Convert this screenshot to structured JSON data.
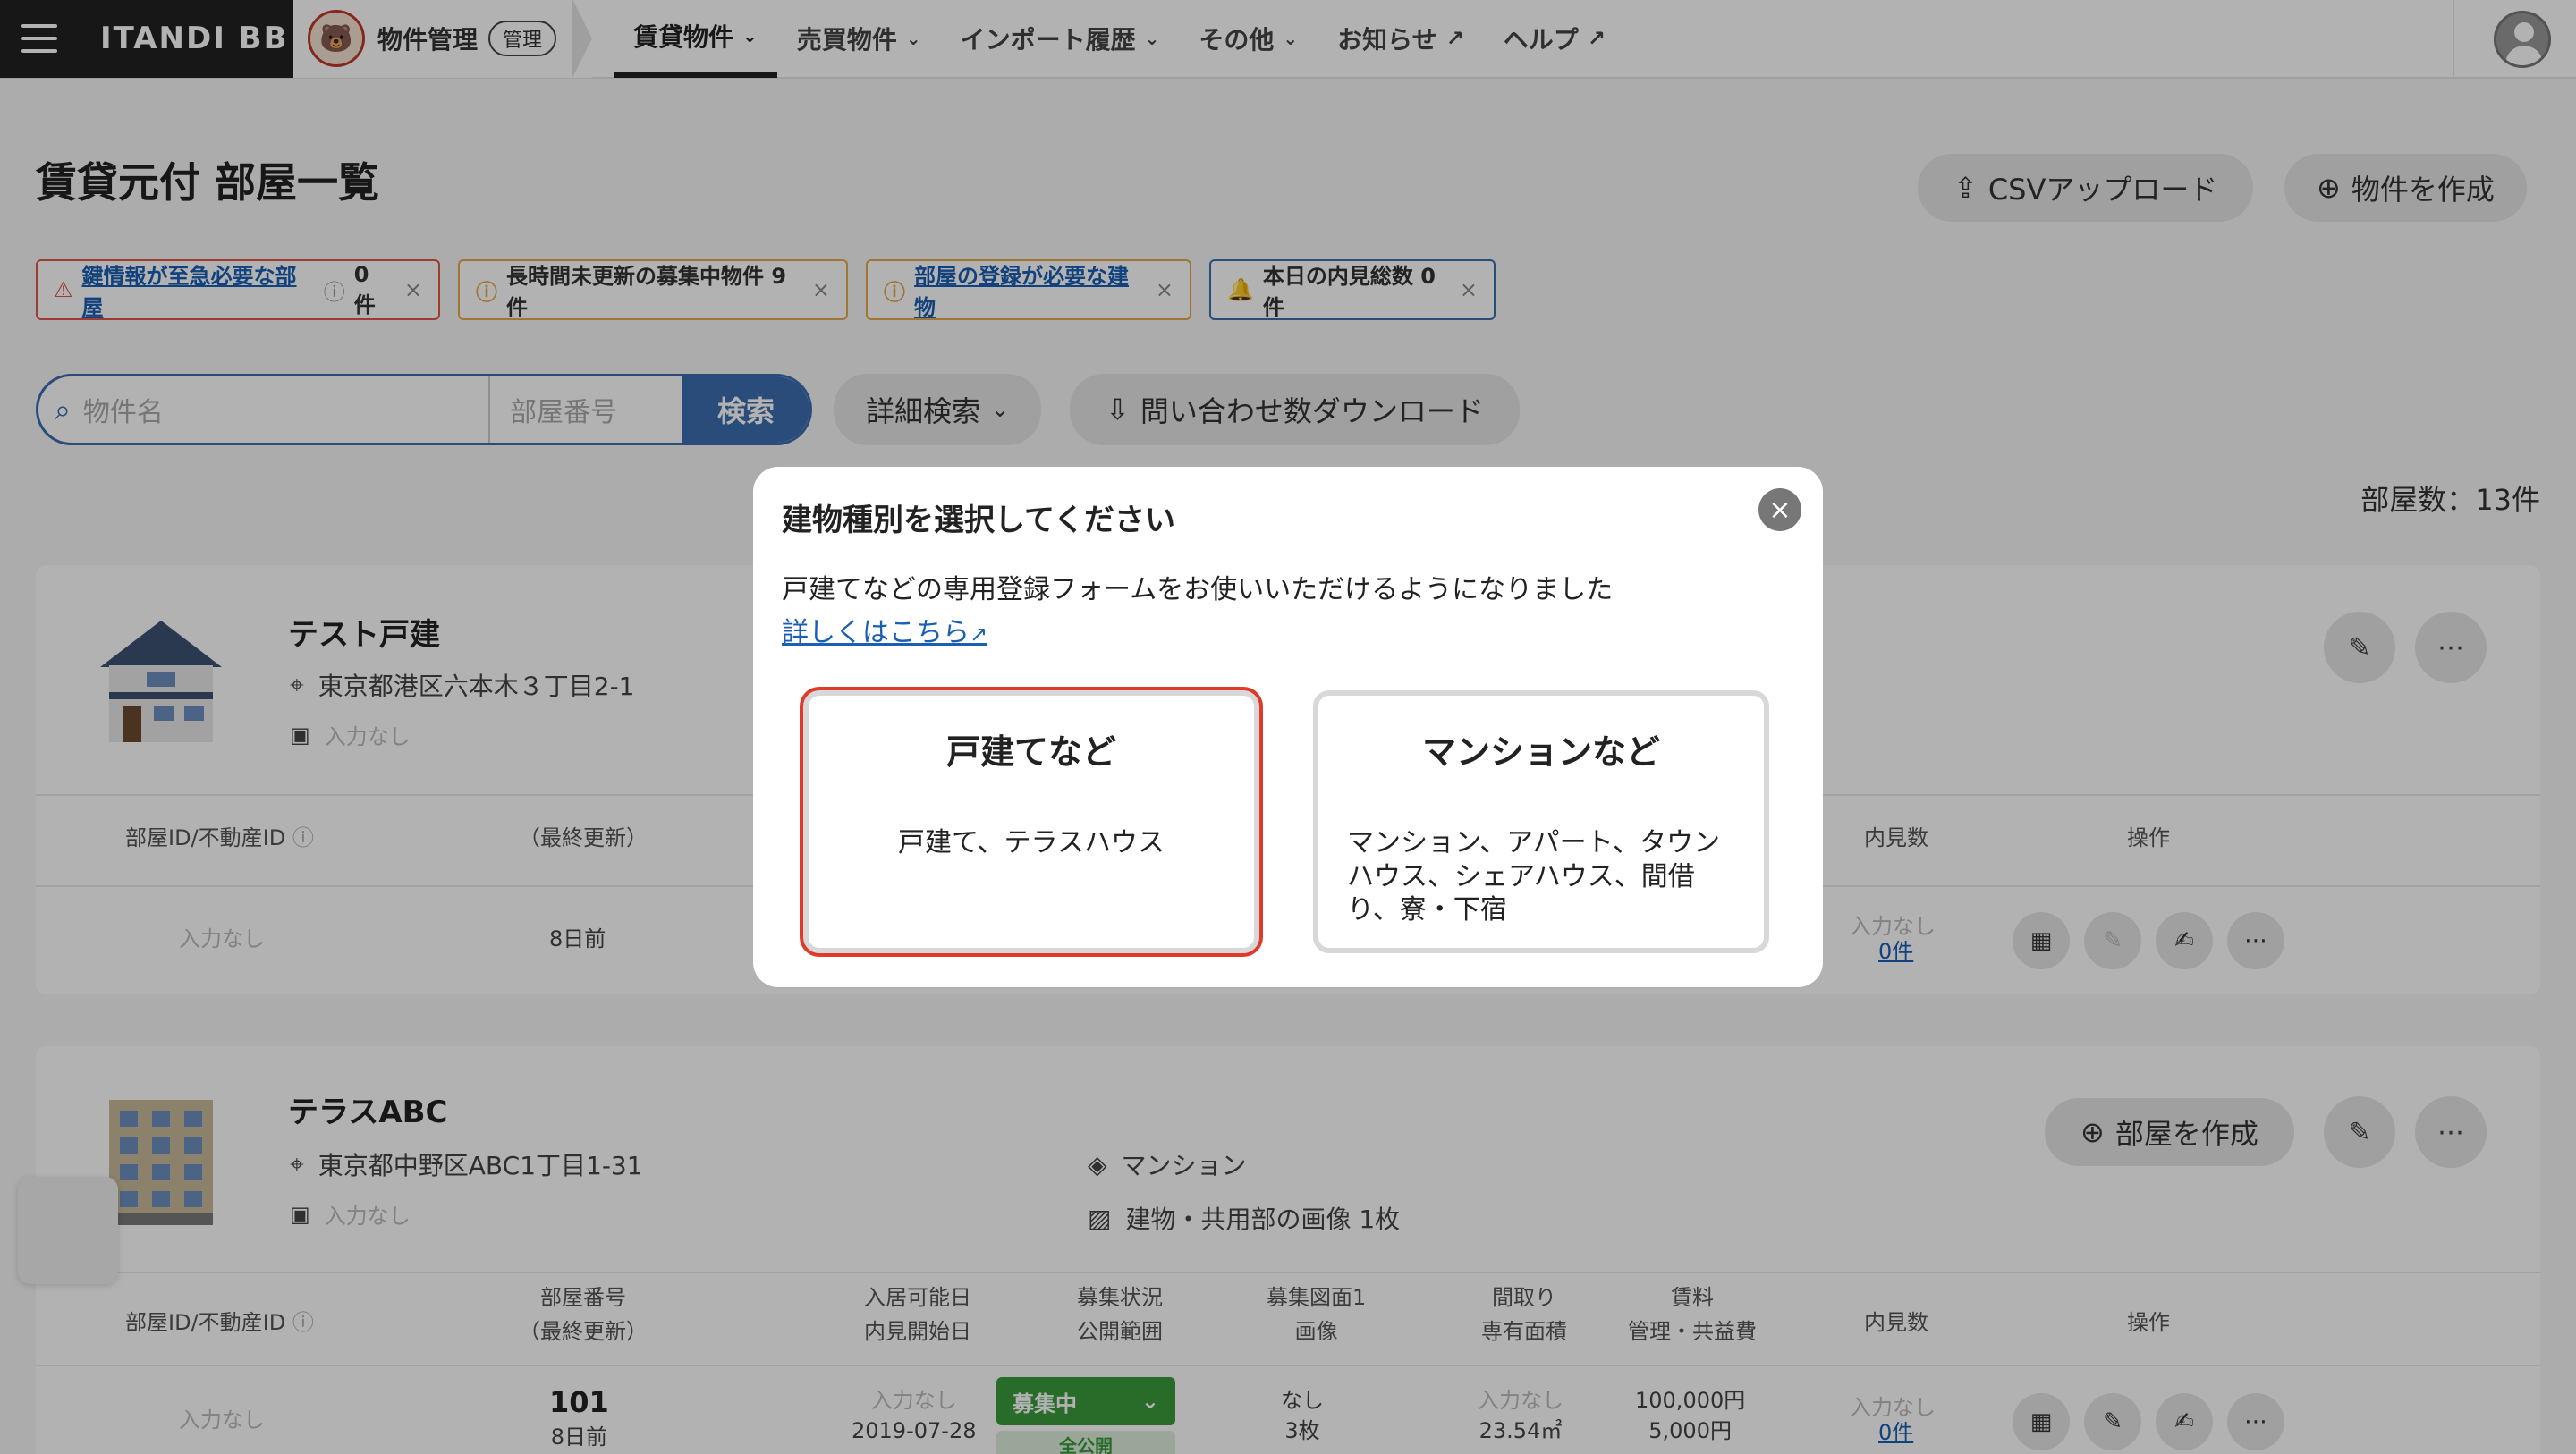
{
  "nav": {
    "logo": "ITANDI BB",
    "app_label": "物件管理",
    "app_badge": "管理",
    "items": [
      {
        "label": "賃貸物件"
      },
      {
        "label": "売買物件"
      },
      {
        "label": "インポート履歴"
      },
      {
        "label": "その他"
      },
      {
        "label": "お知らせ"
      },
      {
        "label": "ヘルプ"
      }
    ]
  },
  "header": {
    "title": "賃貸元付 部屋一覧",
    "csv_button": "CSVアップロード",
    "create_button": "物件を作成"
  },
  "alerts": [
    {
      "text": "鍵情報が至急必要な部屋",
      "count": "0件"
    },
    {
      "text": "長時間未更新の募集中物件 9件"
    },
    {
      "text": "部屋の登録が必要な建物"
    },
    {
      "text": "本日の内見総数 0件"
    }
  ],
  "search": {
    "name_placeholder": "物件名",
    "room_placeholder": "部屋番号",
    "button": "検索",
    "advanced": "詳細検索",
    "download": "問い合わせ数ダウンロード"
  },
  "room_count": "部屋数：13件",
  "properties": [
    {
      "name": "テスト戸建",
      "address": "東京都港区六本木３丁目2-1",
      "station": "入力なし",
      "columns": [
        "部屋ID/不動産ID",
        "（最終更新）",
        "内見数",
        "操作"
      ],
      "row": {
        "id": "入力なし",
        "updated": "8日前",
        "viewing_1": "入力なし",
        "viewing_2": "0件"
      }
    },
    {
      "name": "テラスABC",
      "address": "東京都中野区ABC1丁目1-31",
      "station": "入力なし",
      "type": "マンション",
      "images": "建物・共用部の画像 1枚",
      "create_room": "部屋を作成",
      "columns": [
        {
          "l1": "部屋ID/不動産ID"
        },
        {
          "l1": "部屋番号",
          "l2": "（最終更新）"
        },
        {
          "l1": "入居可能日",
          "l2": "内見開始日"
        },
        {
          "l1": "募集状況",
          "l2": "公開範囲"
        },
        {
          "l1": "募集図面1",
          "l2": "画像"
        },
        {
          "l1": "間取り",
          "l2": "専有面積"
        },
        {
          "l1": "賃料",
          "l2": "管理・共益費"
        },
        {
          "l1": "内見数"
        },
        {
          "l1": "操作"
        }
      ],
      "row": {
        "id": "入力なし",
        "room_no": "101",
        "updated": "8日前",
        "move_in": "入力なし",
        "viewing_start": "2019-07-28",
        "status": "募集中",
        "scope": "全公開",
        "plan": "なし",
        "images": "3枚",
        "layout": "入力なし",
        "area": "23.54㎡",
        "rent": "100,000円",
        "fee": "5,000円",
        "viewing_1": "入力なし",
        "viewing_2": "0件"
      }
    }
  ],
  "modal": {
    "title": "建物種別を選択してください",
    "text": "戸建てなどの専用登録フォームをお使いいただけるようになりました",
    "link": "詳しくはこちら",
    "options": [
      {
        "title": "戸建てなど",
        "desc": "戸建て、テラスハウス"
      },
      {
        "title": "マンションなど",
        "desc": "マンション、アパート、タウンハウス、シェアハウス、間借り、寮・下宿"
      }
    ]
  },
  "colors": {
    "accent": "#3b6db0",
    "selected_border": "#e03a2a",
    "status_green": "#3c9b3c",
    "link": "#1a5fb4"
  }
}
